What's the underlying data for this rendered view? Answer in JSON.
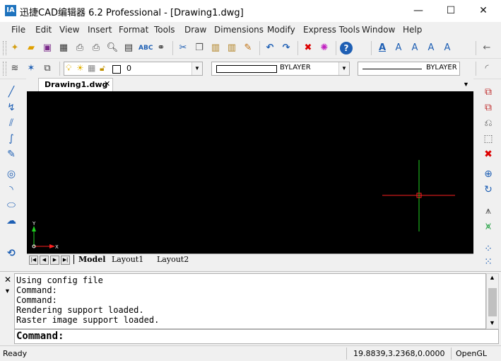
{
  "window": {
    "title": "迅捷CAD编辑器 6.2 Professional  - [Drawing1.dwg]",
    "app_icon": "IA",
    "minimize": "—",
    "maximize": "☐",
    "close": "✕"
  },
  "menu": [
    "File",
    "Edit",
    "View",
    "Insert",
    "Format",
    "Tools",
    "Draw",
    "Dimensions",
    "Modify",
    "Express Tools",
    "Window",
    "Help"
  ],
  "layer_toolbar": {
    "layer_value": "0",
    "linetype_value": "BYLAYER",
    "lineweight_value": "BYLAYER"
  },
  "document": {
    "tab_label": "Drawing1.dwg",
    "tab_close": "✕",
    "ucs_y": "Y",
    "ucs_x": "X",
    "crosshair_color": "#ff2020",
    "crosshair_v_color": "#20d020"
  },
  "layout_tabs": [
    "Model",
    "Layout1",
    "Layout2"
  ],
  "command": {
    "log": [
      "Using config file",
      "Command:",
      "Command:",
      "Rendering support loaded.",
      "Raster image support loaded."
    ],
    "prompt": "Command:"
  },
  "status": {
    "state": "Ready",
    "coordinates": "19.8839,3.2368,0.0000",
    "renderer": "OpenGL"
  },
  "colors": {
    "canvas": "#000000",
    "accent_blue": "#1e5fb4"
  }
}
